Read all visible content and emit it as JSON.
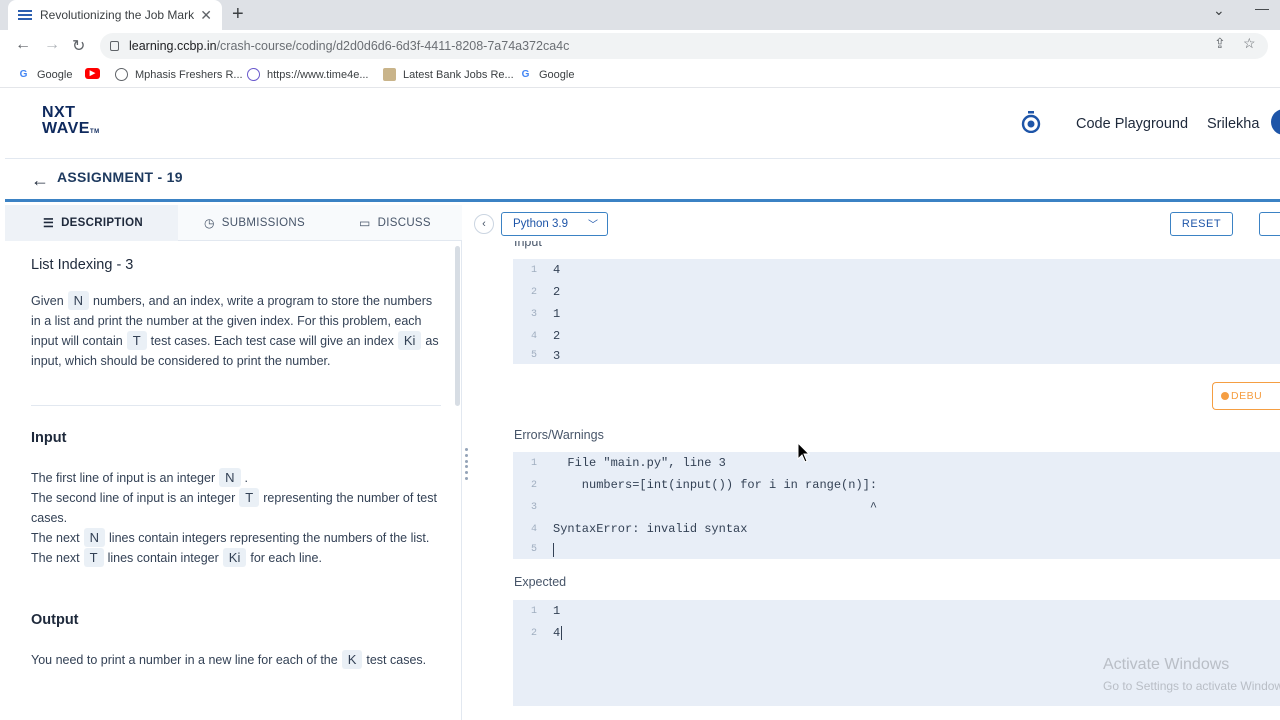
{
  "browser": {
    "tab_title": "Revolutionizing the Job Market |",
    "tab_close": "✕",
    "new_tab": "+",
    "url_host": "learning.ccbp.in",
    "url_path": "/crash-course/coding/d2d0d6d6-6d3f-4411-8208-7a74a372ca4c",
    "bookmarks": [
      {
        "label": "Google",
        "icon": "google-icon",
        "color": "#4285f4"
      },
      {
        "label": "",
        "icon": "youtube-icon",
        "color": "#ff0000"
      },
      {
        "label": "Mphasis Freshers R...",
        "icon": "globe-icon",
        "color": "#5f6368"
      },
      {
        "label": "https://www.time4e...",
        "icon": "time4e-icon",
        "color": "#6a5acd"
      },
      {
        "label": "Latest Bank Jobs Re...",
        "icon": "bank-icon",
        "color": "#8a6d3b"
      },
      {
        "label": "Google",
        "icon": "google-icon",
        "color": "#4285f4"
      }
    ]
  },
  "header": {
    "logo_line1": "NXT",
    "logo_line2": "WAVE",
    "logo_tm": "TM",
    "code_playground": "Code Playground",
    "user_name": "Srilekha"
  },
  "assignment": {
    "back": "←",
    "title": "ASSIGNMENT - 19"
  },
  "left_tabs": {
    "description": "DESCRIPTION",
    "submissions": "SUBMISSIONS",
    "discuss": "DISCUSS"
  },
  "problem": {
    "title": "List Indexing - 3",
    "desc": {
      "p1": "Given",
      "v_n": "N",
      "p2": "numbers, and an index, write a program to store the numbers in a list and print the number at the given index. For this problem, each input will contain",
      "v_t": "T",
      "p3": "test cases. Each test case will give an index",
      "v_ki": "Ki",
      "p4": "as input, which should be considered to print the number."
    },
    "input_heading": "Input",
    "input_lines": [
      {
        "pre": "The first line of input is an integer",
        "var": "N",
        "post": "."
      },
      {
        "pre": "The second line of input is an integer",
        "var": "T",
        "post": "representing the number of test cases."
      },
      {
        "pre": "The next",
        "var": "N",
        "post": "lines contain integers representing the numbers of the list."
      },
      {
        "pre": "The next",
        "var": "T",
        "post": "lines contain integer",
        "var2": "Ki",
        "post2": "for each line."
      }
    ],
    "output_heading": "Output",
    "output_text": {
      "pre": "You need to print a number in a new line for each of the",
      "var": "K",
      "post": "test cases."
    }
  },
  "toolbar": {
    "collapse": "‹",
    "language": "Python 3.9",
    "reset": "RESET"
  },
  "editor": {
    "input_label": "Input",
    "input_lines": [
      "4",
      "2",
      "1",
      "2",
      "3"
    ],
    "debug_label": "DEBU",
    "errors_label": "Errors/Warnings",
    "error_lines": [
      "  File \"main.py\", line 3",
      "    numbers=[int(input()) for i in range(n)]:",
      "                                            ^",
      "SyntaxError: invalid syntax",
      ""
    ],
    "expected_label": "Expected",
    "expected_lines": [
      "1",
      "4"
    ]
  },
  "watermark": {
    "line1": "Activate Windows",
    "line2": "Go to Settings to activate Windows."
  },
  "colors": {
    "accent": "#3b82c4",
    "code_bg": "#e8eef7",
    "debug": "#f59e42"
  }
}
